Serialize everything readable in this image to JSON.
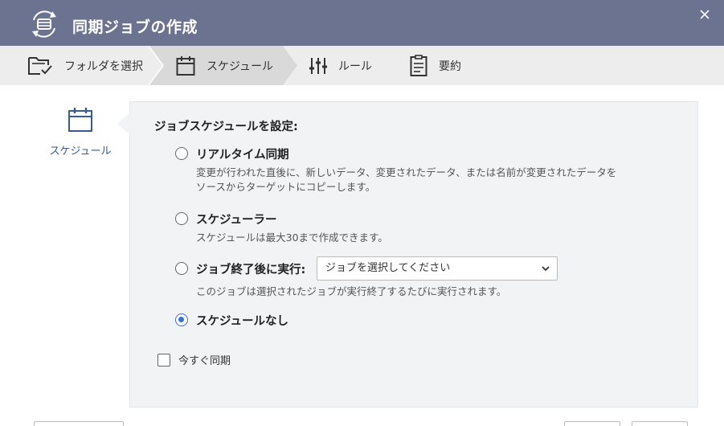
{
  "dialog": {
    "title": "同期ジョブの作成",
    "title_icon": "sync-job-icon",
    "close_icon": "close-icon"
  },
  "steps": [
    {
      "label": "フォルダを選択",
      "icon": "folder-check-icon",
      "active": false
    },
    {
      "label": "スケジュール",
      "icon": "calendar-icon",
      "active": true
    },
    {
      "label": "ルール",
      "icon": "sliders-icon",
      "active": false
    },
    {
      "label": "要約",
      "icon": "summary-icon",
      "active": false
    }
  ],
  "sidenav": {
    "label": "スケジュール",
    "icon": "calendar-icon"
  },
  "form": {
    "heading": "ジョブスケジュールを設定:",
    "options": [
      {
        "label": "リアルタイム同期",
        "desc_line1": "変更が行われた直後に、新しいデータ、変更されたデータ、または名前が変更されたデータを",
        "desc_line2": "ソースからターゲットにコピーします。",
        "checked": false
      },
      {
        "label": "スケジューラー",
        "desc_line1": "スケジュールは最大30まで作成できます。",
        "checked": false
      },
      {
        "label": "ジョブ終了後に実行:",
        "select_value": "ジョブを選択してください",
        "desc_line1": "このジョブは選択されたジョブが実行終了するたびに実行されます。",
        "checked": false
      },
      {
        "label": "スケジュールなし",
        "checked": true
      }
    ],
    "sync_now_label": "今すぐ同期",
    "sync_now_checked": false
  },
  "colors": {
    "titlebar": "#6b7391",
    "accent": "#3b6fd8",
    "nav_label": "#3a5a8c"
  }
}
